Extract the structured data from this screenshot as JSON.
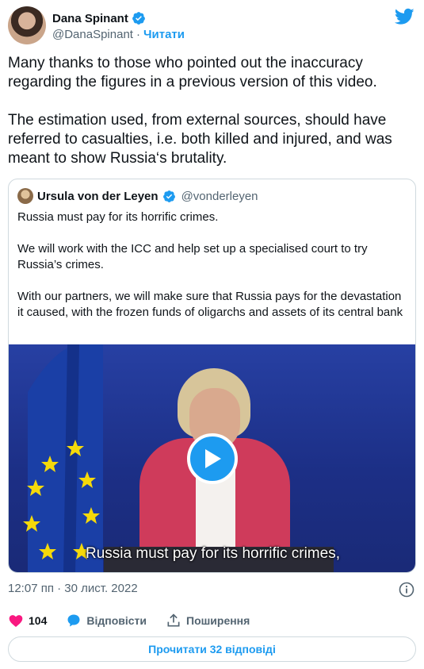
{
  "author": {
    "display_name": "Dana Spinant",
    "handle": "@DanaSpinant",
    "separator": "·",
    "follow_label": "Читати"
  },
  "tweet": {
    "text": "Many thanks to those who pointed out the inaccuracy regarding the figures in a previous version of this video.\n\nThe estimation used, from external sources, should have referred to casualties, i.e. both killed and injured, and was meant to show Russia‘s brutality."
  },
  "quoted": {
    "display_name": "Ursula von der Leyen",
    "handle": "@vonderleyen",
    "text": "Russia must pay for its horrific crimes.\n\nWe will work with the ICC and help set up a specialised court to try Russia’s crimes.\n\nWith our partners, we will make sure that Russia pays for the devastation it caused, with the frozen funds of oligarchs and assets of its central bank",
    "video_caption": "Russia must pay for its horrific crimes,"
  },
  "meta": {
    "timestamp": "12:07 пп · 30 лист. 2022"
  },
  "actions": {
    "likes_count": "104",
    "reply_label": "Відповісти",
    "share_label": "Поширення"
  },
  "footer": {
    "read_replies_label": "Прочитати 32 відповіді"
  },
  "colors": {
    "accent": "#1d9bf0",
    "like": "#f91880",
    "muted": "#536471"
  },
  "icons": [
    "verified-badge-icon",
    "twitter-bird-icon",
    "play-icon",
    "info-icon",
    "heart-icon",
    "reply-bubble-icon",
    "share-icon"
  ]
}
